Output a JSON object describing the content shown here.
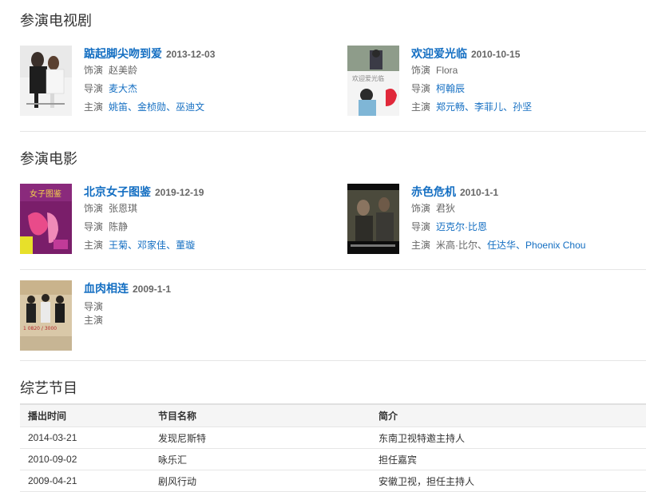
{
  "sections": {
    "tv_title": "参演电视剧",
    "movie_title": "参演电影",
    "variety_title": "综艺节目"
  },
  "labels": {
    "role": "饰演",
    "director": "导演",
    "cast": "主演"
  },
  "tv": [
    {
      "title": "踮起脚尖吻到爱",
      "date": "2013-12-03",
      "role": "赵美龄",
      "director": "麦大杰",
      "cast": [
        "姚笛",
        "金桢勋",
        "巫迪文"
      ]
    },
    {
      "title": "欢迎爱光临",
      "date": "2010-10-15",
      "role": "Flora",
      "director": "柯翰辰",
      "cast": [
        "郑元畅",
        "李菲儿",
        "孙坚"
      ]
    }
  ],
  "movies": [
    {
      "title": "北京女子图鉴",
      "date": "2019-12-19",
      "role": "张恩琪",
      "director": "陈静",
      "cast": [
        "王菊",
        "邓家佳",
        "董璇"
      ]
    },
    {
      "title": "赤色危机",
      "date": "2010-1-1",
      "role": "君狄",
      "director": "迈克尔·比恩",
      "cast_plain": "米高·比尔、",
      "cast": [
        "任达华",
        "Phoenix Chou"
      ]
    },
    {
      "title": "血肉相连",
      "date": "2009-1-1"
    }
  ],
  "variety": {
    "headers": [
      "播出时间",
      "节目名称",
      "简介"
    ],
    "rows": [
      [
        "2014-03-21",
        "发现尼斯特",
        "东南卫视特邀主持人"
      ],
      [
        "2010-09-02",
        "咏乐汇",
        "担任嘉宾"
      ],
      [
        "2009-04-21",
        "剧风行动",
        "安徽卫视，担任主持人"
      ]
    ]
  },
  "poster_text": {
    "tv2": "欢迎爱光临",
    "movie1": "女子图鉴",
    "movie3": "1 0820 / 3000"
  }
}
